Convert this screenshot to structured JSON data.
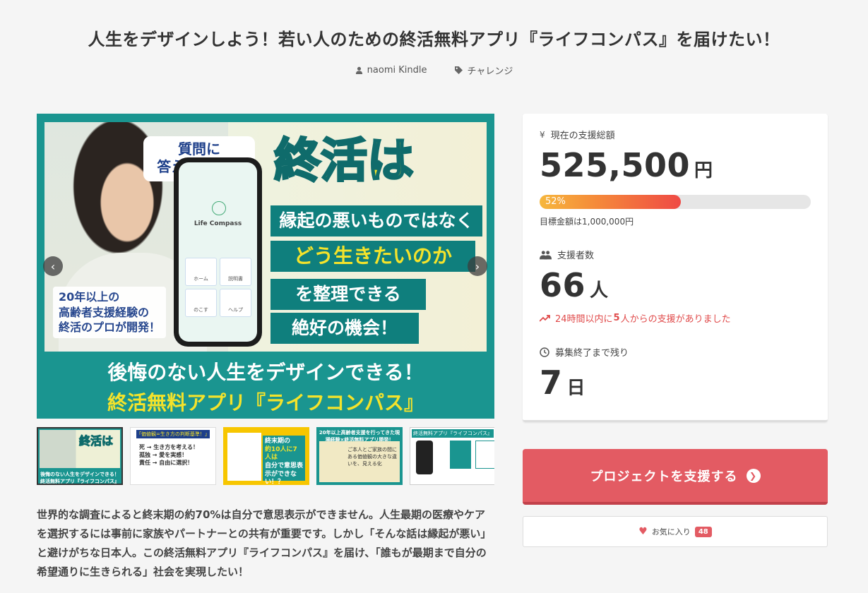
{
  "project": {
    "title": "人生をデザインしよう！若い人のための終活無料アプリ『ライフコンパス』を届けたい！",
    "author": "naomi Kindle",
    "category": "チャレンジ"
  },
  "hero": {
    "bubble": "質問に\n答えるだけ！",
    "app_name": "Life Compass",
    "menu": [
      "ホーム",
      "説明書",
      "のこす",
      "ヘルプ"
    ],
    "experience": "20年以上の\n高齢者支援経験の\n終活のプロが開発！",
    "headline": "終活は",
    "band1": "縁起の悪いものではなく",
    "band2": "どう生きたいのか",
    "band3": "を整理できる",
    "band4": "絶好の機会！",
    "bottom1": "後悔のない人生をデザインできる！",
    "bottom2": "終活無料アプリ『ライフコンパス』"
  },
  "thumbnails": [
    {
      "caption": "後悔のない人生をデザインできる！終活無料アプリ『ライフコンパス』",
      "mark": "終活は"
    },
    {
      "header": "「価値観=生き方の判断基準！」",
      "rows": [
        "死 → 生き方を考える！",
        "孤独 → 愛を実感！",
        "責任 → 自由に選択！"
      ]
    },
    {
      "panel_top": "終末期の",
      "panel_mid": "約10人に7人は",
      "panel_bot": "自分で意思表示ができない！？"
    },
    {
      "header": "20年以上高齢者支援を行ってきた現場経験×終活無料アプリ開発！",
      "body": "ご本人とご家族の間にある価値観の大きな違いを、見える化"
    },
    {
      "header": "終活無料アプリ『ライフコンパス』を使うと？"
    }
  ],
  "description": "世界的な調査によると終末期の約70%は自分で意思表示ができません。人生最期の医療やケアを選択するには事前に家族やパートナーとの共有が重要です。しかし「そんな話は縁起が悪い」と避けがちな日本人。この終活無料アプリ『ライフコンパス』を届け、「誰もが最期まで自分の希望通りに生きられる」社会を実現したい！",
  "stats": {
    "total_label": "現在の支援総額",
    "total_value": "525,500",
    "total_unit": "円",
    "progress_percent": 52,
    "progress_label": "52%",
    "goal_text": "目標金額は1,000,000円",
    "backers_label": "支援者数",
    "backers_value": "66",
    "backers_unit": "人",
    "recent_prefix": "24時間以内に",
    "recent_count": "5",
    "recent_suffix": "人からの支援がありました",
    "remaining_label": "募集終了まで残り",
    "remaining_value": "7",
    "remaining_unit": "日"
  },
  "actions": {
    "support_label": "プロジェクトを支援する",
    "favorite_label": "お気に入り",
    "favorite_count": "48"
  },
  "colors": {
    "accent": "#e35b63",
    "teal": "#1a9590",
    "recent_red": "#e04a4a"
  }
}
